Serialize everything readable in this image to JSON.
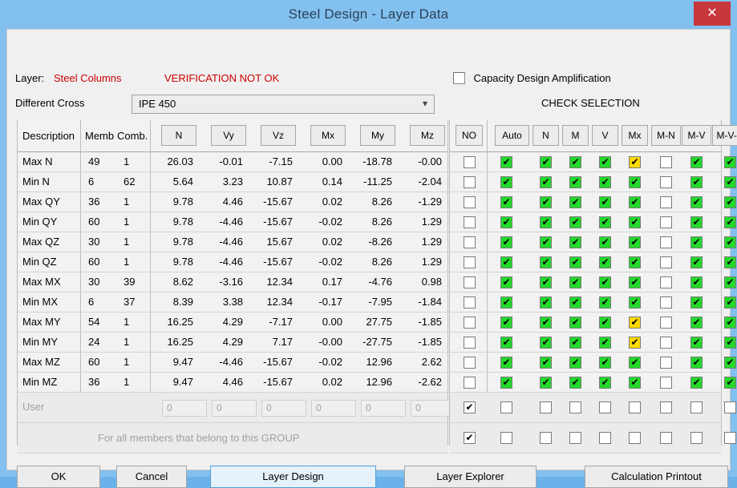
{
  "window": {
    "title": "Steel Design - Layer Data",
    "close_icon": "close-icon",
    "close_glyph": "✕",
    "accent_titlebar": "#82c0f0",
    "close_color": "#c8373b"
  },
  "header": {
    "layer_label": "Layer:",
    "layer_value": "Steel Columns",
    "verification_status": "VERIFICATION NOT OK",
    "verification_color": "#cc0000",
    "different_cross_label": "Different Cross",
    "section_value": "IPE 450",
    "section_dropdown_icon": "chevron-down-icon",
    "capacity_label": "Capacity Design Amplification",
    "capacity_checked": false,
    "check_selection_label": "CHECK SELECTION"
  },
  "left_table": {
    "headers": {
      "description": "Description",
      "member": "Memb",
      "comb": "Comb.",
      "force_buttons": [
        "N",
        "Vy",
        "Vz",
        "Mx",
        "My",
        "Mz"
      ]
    },
    "rows": [
      {
        "desc": "Max N",
        "member": "49",
        "comb": "1",
        "N": "26.03",
        "Vy": "-0.01",
        "Vz": "-7.15",
        "Mx": "0.00",
        "My": "-18.78",
        "Mz": "-0.00"
      },
      {
        "desc": "Min N",
        "member": "6",
        "comb": "62",
        "N": "5.64",
        "Vy": "3.23",
        "Vz": "10.87",
        "Mx": "0.14",
        "My": "-11.25",
        "Mz": "-2.04"
      },
      {
        "desc": "Max QY",
        "member": "36",
        "comb": "1",
        "N": "9.78",
        "Vy": "4.46",
        "Vz": "-15.67",
        "Mx": "0.02",
        "My": "8.26",
        "Mz": "-1.29"
      },
      {
        "desc": "Min QY",
        "member": "60",
        "comb": "1",
        "N": "9.78",
        "Vy": "-4.46",
        "Vz": "-15.67",
        "Mx": "-0.02",
        "My": "8.26",
        "Mz": "1.29"
      },
      {
        "desc": "Max QZ",
        "member": "30",
        "comb": "1",
        "N": "9.78",
        "Vy": "-4.46",
        "Vz": "15.67",
        "Mx": "0.02",
        "My": "-8.26",
        "Mz": "1.29"
      },
      {
        "desc": "Min QZ",
        "member": "60",
        "comb": "1",
        "N": "9.78",
        "Vy": "-4.46",
        "Vz": "-15.67",
        "Mx": "-0.02",
        "My": "8.26",
        "Mz": "1.29"
      },
      {
        "desc": "Max MX",
        "member": "30",
        "comb": "39",
        "N": "8.62",
        "Vy": "-3.16",
        "Vz": "12.34",
        "Mx": "0.17",
        "My": "-4.76",
        "Mz": "0.98"
      },
      {
        "desc": "Min MX",
        "member": "6",
        "comb": "37",
        "N": "8.39",
        "Vy": "3.38",
        "Vz": "12.34",
        "Mx": "-0.17",
        "My": "-7.95",
        "Mz": "-1.84"
      },
      {
        "desc": "Max MY",
        "member": "54",
        "comb": "1",
        "N": "16.25",
        "Vy": "4.29",
        "Vz": "-7.17",
        "Mx": "0.00",
        "My": "27.75",
        "Mz": "-1.85"
      },
      {
        "desc": "Min MY",
        "member": "24",
        "comb": "1",
        "N": "16.25",
        "Vy": "4.29",
        "Vz": "7.17",
        "Mx": "-0.00",
        "My": "-27.75",
        "Mz": "-1.85"
      },
      {
        "desc": "Max MZ",
        "member": "60",
        "comb": "1",
        "N": "9.47",
        "Vy": "-4.46",
        "Vz": "-15.67",
        "Mx": "-0.02",
        "My": "12.96",
        "Mz": "2.62"
      },
      {
        "desc": "Min MZ",
        "member": "36",
        "comb": "1",
        "N": "9.47",
        "Vy": "4.46",
        "Vz": "-15.67",
        "Mx": "0.02",
        "My": "12.96",
        "Mz": "-2.62"
      }
    ],
    "user_row": {
      "desc": "User",
      "inputs": [
        "0",
        "0",
        "0",
        "0",
        "0",
        "0"
      ]
    },
    "group_row": {
      "text": "For all members that belong to this GROUP"
    }
  },
  "right_table": {
    "headers": {
      "no": "NO",
      "checks": [
        "Auto",
        "N",
        "M",
        "V",
        "Mx",
        "M-N",
        "M-V",
        "M-V-N"
      ]
    },
    "rows": [
      {
        "no": "off",
        "checks": [
          "green",
          "green",
          "green",
          "green",
          "yellow",
          "off",
          "green",
          "green"
        ]
      },
      {
        "no": "off",
        "checks": [
          "green",
          "green",
          "green",
          "green",
          "green",
          "off",
          "green",
          "green"
        ]
      },
      {
        "no": "off",
        "checks": [
          "green",
          "green",
          "green",
          "green",
          "green",
          "off",
          "green",
          "green"
        ]
      },
      {
        "no": "off",
        "checks": [
          "green",
          "green",
          "green",
          "green",
          "green",
          "off",
          "green",
          "green"
        ]
      },
      {
        "no": "off",
        "checks": [
          "green",
          "green",
          "green",
          "green",
          "green",
          "off",
          "green",
          "green"
        ]
      },
      {
        "no": "off",
        "checks": [
          "green",
          "green",
          "green",
          "green",
          "green",
          "off",
          "green",
          "green"
        ]
      },
      {
        "no": "off",
        "checks": [
          "green",
          "green",
          "green",
          "green",
          "green",
          "off",
          "green",
          "green"
        ]
      },
      {
        "no": "off",
        "checks": [
          "green",
          "green",
          "green",
          "green",
          "green",
          "off",
          "green",
          "green"
        ]
      },
      {
        "no": "off",
        "checks": [
          "green",
          "green",
          "green",
          "green",
          "yellow",
          "off",
          "green",
          "green"
        ]
      },
      {
        "no": "off",
        "checks": [
          "green",
          "green",
          "green",
          "green",
          "yellow",
          "off",
          "green",
          "green"
        ]
      },
      {
        "no": "off",
        "checks": [
          "green",
          "green",
          "green",
          "green",
          "green",
          "off",
          "green",
          "green"
        ]
      },
      {
        "no": "off",
        "checks": [
          "green",
          "green",
          "green",
          "green",
          "green",
          "off",
          "green",
          "green"
        ]
      },
      {
        "no": "on",
        "checks": [
          "off",
          "off",
          "off",
          "off",
          "off",
          "off",
          "off",
          "off"
        ]
      },
      {
        "no": "on",
        "checks": [
          "off",
          "off",
          "off",
          "off",
          "off",
          "off",
          "off",
          "off"
        ]
      }
    ],
    "check_glyph": "✔",
    "green_color": "#23d92b",
    "yellow_color": "#ffd900"
  },
  "footer": {
    "buttons": [
      {
        "label": "OK",
        "focused": false
      },
      {
        "label": "Cancel",
        "focused": false
      },
      {
        "label": "Layer Design",
        "focused": true
      },
      {
        "label": "Layer Explorer",
        "focused": false
      },
      {
        "label": "Calculation Printout",
        "focused": false
      }
    ]
  }
}
